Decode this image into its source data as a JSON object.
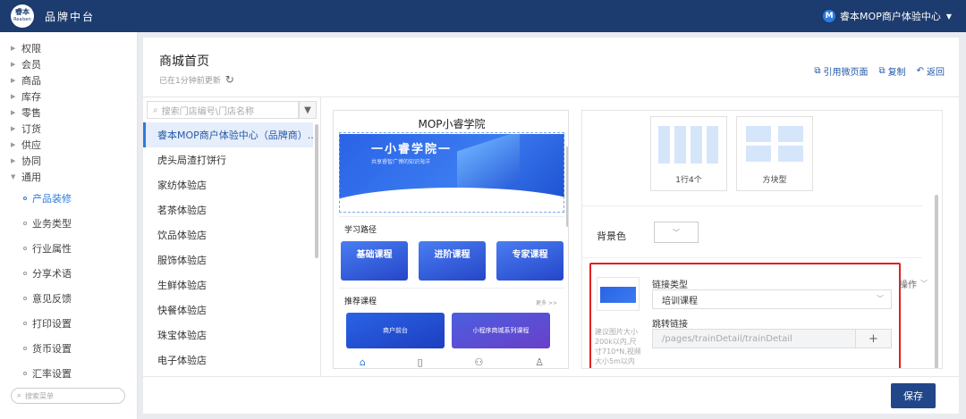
{
  "app": {
    "logo_text": "睿本",
    "logo_sub": "Realsen",
    "title": "品牌中台",
    "user_initial": "M",
    "user_name": "睿本MOP商户体验中心"
  },
  "sidebar": {
    "items": [
      {
        "label": "权限"
      },
      {
        "label": "会员"
      },
      {
        "label": "商品"
      },
      {
        "label": "库存"
      },
      {
        "label": "零售"
      },
      {
        "label": "订货"
      },
      {
        "label": "供应"
      },
      {
        "label": "协同"
      },
      {
        "label": "通用"
      }
    ],
    "sub_items": [
      {
        "label": "产品装修",
        "active": true
      },
      {
        "label": "业务类型"
      },
      {
        "label": "行业属性"
      },
      {
        "label": "分享术语"
      },
      {
        "label": "意见反馈"
      },
      {
        "label": "打印设置"
      },
      {
        "label": "货币设置"
      },
      {
        "label": "汇率设置"
      }
    ],
    "search_placeholder": "搜索菜单"
  },
  "page": {
    "title": "商城首页",
    "updated": "已在1分钟前更新",
    "actions": {
      "cite": "引用微页面",
      "copy": "复制",
      "back": "返回"
    }
  },
  "stores": {
    "search_placeholder": "搜索门店编号\\门店名称",
    "items": [
      "睿本MOP商户体验中心（品牌商）...",
      "虎头局渣打饼行",
      "家纺体验店",
      "茗茶体验店",
      "饮品体验店",
      "服饰体验店",
      "生鲜体验店",
      "快餐体验店",
      "珠宝体验店",
      "电子体验店"
    ]
  },
  "preview": {
    "title": "MOP小睿学院",
    "banner_title": "一小睿学院一",
    "banner_sub": "共享睿智广博的知识海洋",
    "section_path": "学习路径",
    "courses": [
      "基础课程",
      "进阶课程",
      "专家课程"
    ],
    "section_rec": "推荐课程",
    "more": "更多 >>",
    "rec_cards": [
      "商户前台",
      "小程序商城系列课程"
    ]
  },
  "config": {
    "templates": [
      "1行4个",
      "方块型"
    ],
    "bg_color_label": "背景色",
    "hint": "建议图片大小200k以内,尺寸710*N,视频大小5m以内",
    "link_type_label": "链接类型",
    "link_type_value": "培训课程",
    "jump_link_label": "跳转链接",
    "jump_link_value": "/pages/trainDetail/trainDetail",
    "operation_label": "操作"
  },
  "footer": {
    "save": "保存"
  },
  "colors": {
    "topbar": "#1c3b6e",
    "accent": "#2d7be0",
    "highlight_box": "#e02020",
    "save_button": "#21468a"
  }
}
